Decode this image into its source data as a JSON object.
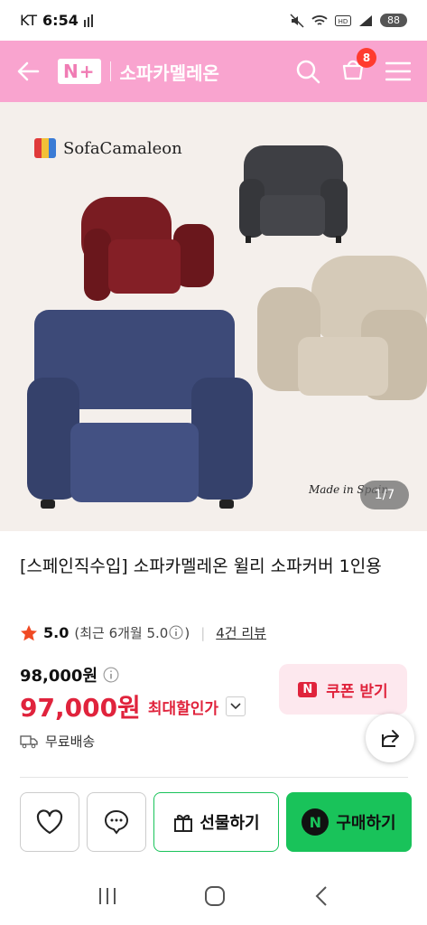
{
  "status_bar": {
    "carrier": "KT",
    "time": "6:54",
    "battery": "88"
  },
  "header": {
    "brand_badge": "N+",
    "store_name": "소파카멜레온",
    "cart_count": "8"
  },
  "gallery": {
    "brand_text": "SofaCamaleon",
    "made_text": "Made in Spain",
    "pager": "1/7"
  },
  "product": {
    "title": "[스페인직수입] 소파카멜레온 윌리 소파커버 1인용",
    "rating_score": "5.0",
    "rating_recent": "(최근 6개월 5.0",
    "rating_recent_close": ")",
    "review_count": "4건 리뷰",
    "original_price": "98,000원",
    "sale_price": "97,000원",
    "max_discount": "최대할인가",
    "coupon_label": "쿠폰 받기",
    "coupon_logo": "N",
    "delivery": "무료배송"
  },
  "actions": {
    "gift": "선물하기",
    "buy": "구매하기",
    "buy_logo": "N"
  },
  "colors": {
    "header_pink": "#f9a4cf",
    "price_red": "#e0233c",
    "naver_green": "#19c35a"
  }
}
